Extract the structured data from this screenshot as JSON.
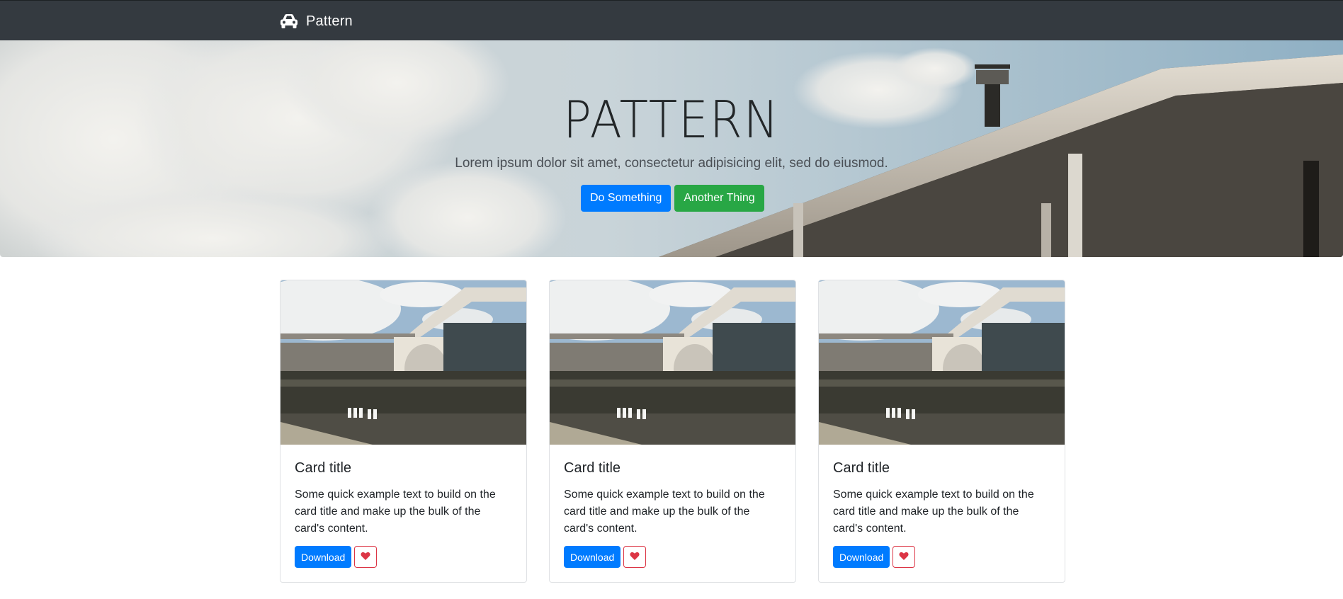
{
  "navbar": {
    "brand_icon": "car-icon",
    "brand_label": "Pattern"
  },
  "hero": {
    "title": "PATTERN",
    "lead": "Lorem ipsum dolor sit amet, consectetur adipisicing elit, sed do eiusmod.",
    "primary_button": "Do Something",
    "secondary_button": "Another Thing"
  },
  "cards": [
    {
      "title": "Card title",
      "text": "Some quick example text to build on the card title and make up the bulk of the card's content.",
      "download_label": "Download",
      "favorite_icon": "heart-icon"
    },
    {
      "title": "Card title",
      "text": "Some quick example text to build on the card title and make up the bulk of the card's content.",
      "download_label": "Download",
      "favorite_icon": "heart-icon"
    },
    {
      "title": "Card title",
      "text": "Some quick example text to build on the card title and make up the bulk of the card's content.",
      "download_label": "Download",
      "favorite_icon": "heart-icon"
    }
  ],
  "colors": {
    "navbar_bg": "#343a40",
    "primary": "#007bff",
    "success": "#28a745",
    "danger": "#dc3545"
  }
}
